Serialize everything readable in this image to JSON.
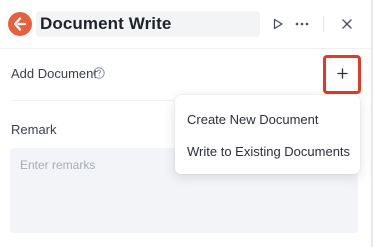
{
  "header": {
    "title": "Document Write",
    "app_icon": "document-write-logo",
    "actions": [
      {
        "icon": "play-icon"
      },
      {
        "icon": "more-icon"
      },
      {
        "icon": "close-icon"
      }
    ]
  },
  "add_document": {
    "label": "Add Document",
    "help_icon": "help-circle-icon",
    "add_icon": "plus-icon"
  },
  "remark": {
    "label": "Remark",
    "value": "",
    "placeholder": "Enter remarks"
  },
  "dropdown": {
    "items": [
      {
        "label": "Create New Document"
      },
      {
        "label": "Write to Existing Documents"
      }
    ]
  },
  "colors": {
    "brand": "#e9603f",
    "highlight": "#e03a28",
    "input_bg": "#f3f4f8"
  }
}
